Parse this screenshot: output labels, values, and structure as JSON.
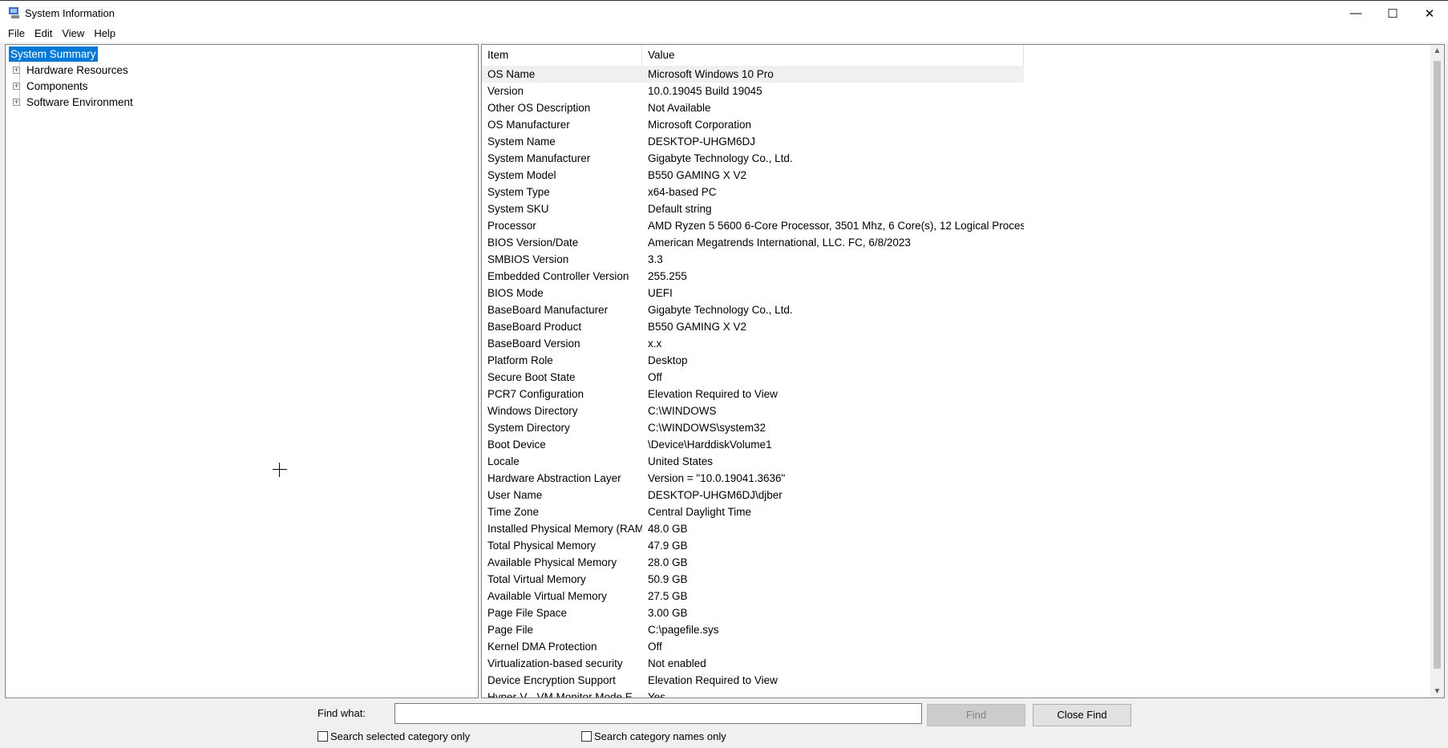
{
  "window": {
    "title": "System Information",
    "minimize": "—",
    "maximize": "☐",
    "close": "✕"
  },
  "menu": [
    "File",
    "Edit",
    "View",
    "Help"
  ],
  "tree": {
    "items": [
      {
        "label": "System Summary",
        "selected": true
      },
      {
        "label": "Hardware Resources"
      },
      {
        "label": "Components"
      },
      {
        "label": "Software Environment"
      }
    ]
  },
  "list": {
    "columns": [
      "Item",
      "Value"
    ],
    "rows": [
      [
        "OS Name",
        "Microsoft Windows 10 Pro"
      ],
      [
        "Version",
        "10.0.19045 Build 19045"
      ],
      [
        "Other OS Description",
        "Not Available"
      ],
      [
        "OS Manufacturer",
        "Microsoft Corporation"
      ],
      [
        "System Name",
        "DESKTOP-UHGM6DJ"
      ],
      [
        "System Manufacturer",
        "Gigabyte Technology Co., Ltd."
      ],
      [
        "System Model",
        "B550 GAMING X V2"
      ],
      [
        "System Type",
        "x64-based PC"
      ],
      [
        "System SKU",
        "Default string"
      ],
      [
        "Processor",
        "AMD Ryzen 5 5600 6-Core Processor, 3501 Mhz, 6 Core(s), 12 Logical Proces..."
      ],
      [
        "BIOS Version/Date",
        "American Megatrends International, LLC. FC, 6/8/2023"
      ],
      [
        "SMBIOS Version",
        "3.3"
      ],
      [
        "Embedded Controller Version",
        "255.255"
      ],
      [
        "BIOS Mode",
        "UEFI"
      ],
      [
        "BaseBoard Manufacturer",
        "Gigabyte Technology Co., Ltd."
      ],
      [
        "BaseBoard Product",
        "B550 GAMING X V2"
      ],
      [
        "BaseBoard Version",
        "x.x"
      ],
      [
        "Platform Role",
        "Desktop"
      ],
      [
        "Secure Boot State",
        "Off"
      ],
      [
        "PCR7 Configuration",
        "Elevation Required to View"
      ],
      [
        "Windows Directory",
        "C:\\WINDOWS"
      ],
      [
        "System Directory",
        "C:\\WINDOWS\\system32"
      ],
      [
        "Boot Device",
        "\\Device\\HarddiskVolume1"
      ],
      [
        "Locale",
        "United States"
      ],
      [
        "Hardware Abstraction Layer",
        "Version = \"10.0.19041.3636\""
      ],
      [
        "User Name",
        "DESKTOP-UHGM6DJ\\djber"
      ],
      [
        "Time Zone",
        "Central Daylight Time"
      ],
      [
        "Installed Physical Memory (RAM)",
        "48.0 GB"
      ],
      [
        "Total Physical Memory",
        "47.9 GB"
      ],
      [
        "Available Physical Memory",
        "28.0 GB"
      ],
      [
        "Total Virtual Memory",
        "50.9 GB"
      ],
      [
        "Available Virtual Memory",
        "27.5 GB"
      ],
      [
        "Page File Space",
        "3.00 GB"
      ],
      [
        "Page File",
        "C:\\pagefile.sys"
      ],
      [
        "Kernel DMA Protection",
        "Off"
      ],
      [
        "Virtualization-based security",
        "Not enabled"
      ],
      [
        "Device Encryption Support",
        "Elevation Required to View"
      ],
      [
        "Hyper-V - VM Monitor Mode E...",
        "Yes"
      ]
    ]
  },
  "find": {
    "label": "Find what:",
    "value": "",
    "find_button": "Find",
    "close_button": "Close Find",
    "check_selected": "Search selected category only",
    "check_names": "Search category names only"
  },
  "colors": {
    "selection": "#0078d7"
  }
}
